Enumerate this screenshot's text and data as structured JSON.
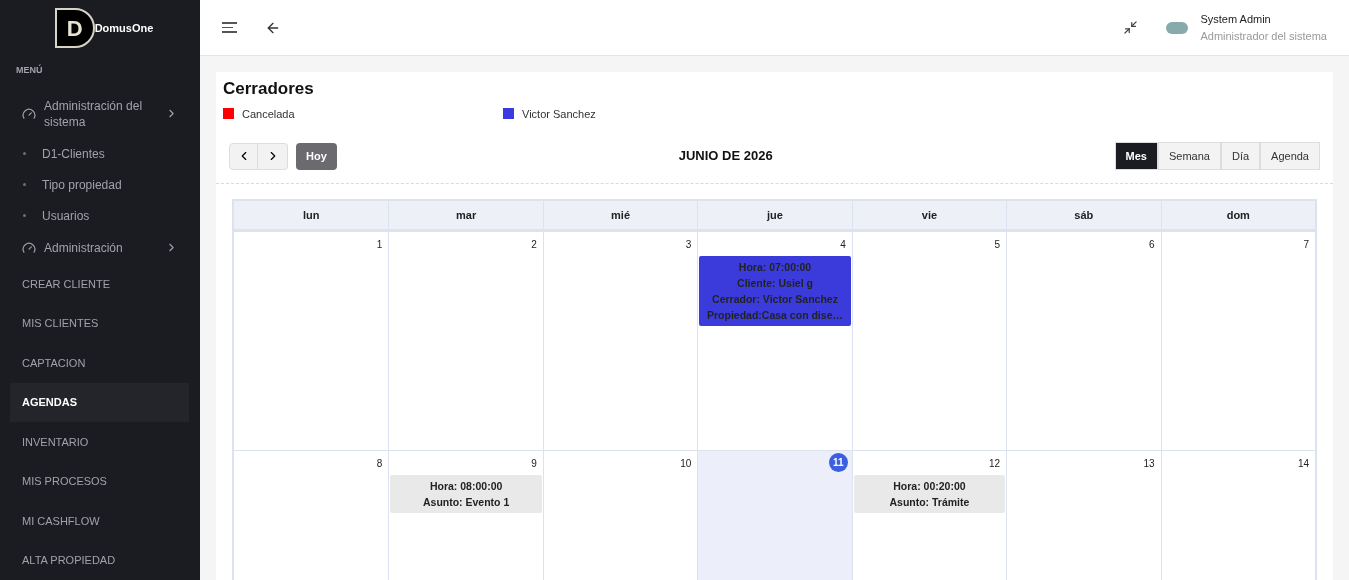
{
  "brand": {
    "logo_letter": "D",
    "name": "DomusOne"
  },
  "sidebar": {
    "heading": "MENÚ",
    "items": [
      {
        "kind": "group",
        "label": "Administración del sistema",
        "selected": false
      },
      {
        "kind": "sub",
        "label": "D1-Clientes",
        "selected": false
      },
      {
        "kind": "sub",
        "label": "Tipo propiedad",
        "selected": false
      },
      {
        "kind": "sub",
        "label": "Usuarios",
        "selected": false
      },
      {
        "kind": "group",
        "label": "Administración",
        "selected": false
      },
      {
        "kind": "link",
        "label": "CREAR CLIENTE",
        "selected": false
      },
      {
        "kind": "link",
        "label": "MIS CLIENTES",
        "selected": false
      },
      {
        "kind": "link",
        "label": "CAPTACION",
        "selected": false
      },
      {
        "kind": "link",
        "label": "AGENDAS",
        "selected": true
      },
      {
        "kind": "link",
        "label": "INVENTARIO",
        "selected": false
      },
      {
        "kind": "link",
        "label": "MIS PROCESOS",
        "selected": false
      },
      {
        "kind": "link",
        "label": "MI CASHFLOW",
        "selected": false
      },
      {
        "kind": "link",
        "label": "ALTA PROPIEDAD",
        "selected": false
      }
    ]
  },
  "user": {
    "name": "System Admin",
    "role": "Administrador del sistema"
  },
  "page": {
    "title": "Cerradores",
    "legend": [
      {
        "label": "Cancelada",
        "color": "#ff0000"
      },
      {
        "label": "Victor Sanchez",
        "color": "#3a3ae0"
      }
    ]
  },
  "toolbar": {
    "today_button": "Hoy",
    "period": "JUNIO DE 2026",
    "views": [
      {
        "label": "Mes",
        "selected": true
      },
      {
        "label": "Semana",
        "selected": false
      },
      {
        "label": "Día",
        "selected": false
      },
      {
        "label": "Agenda",
        "selected": false
      }
    ]
  },
  "calendar": {
    "weekdays": [
      "lun",
      "mar",
      "mié",
      "jue",
      "vie",
      "sáb",
      "dom"
    ],
    "weeks": [
      [
        {
          "day": "1",
          "today": false
        },
        {
          "day": "2",
          "today": false
        },
        {
          "day": "3",
          "today": false
        },
        {
          "day": "4",
          "today": false,
          "events": [
            {
              "color": "#3b3bdc",
              "lines": [
                "Hora: 07:00:00",
                "Cliente: Usiel g",
                "Cerrador: Victor Sanchez",
                "Propiedad:Casa con dise…"
              ]
            }
          ]
        },
        {
          "day": "5",
          "today": false
        },
        {
          "day": "6",
          "today": false
        },
        {
          "day": "7",
          "today": false
        }
      ],
      [
        {
          "day": "8",
          "today": false
        },
        {
          "day": "9",
          "today": false,
          "events": [
            {
              "color": "#e9e9e9",
              "lines": [
                "Hora: 08:00:00",
                "Asunto: Evento 1"
              ]
            }
          ]
        },
        {
          "day": "10",
          "today": false
        },
        {
          "day": "11",
          "today": true
        },
        {
          "day": "12",
          "today": false,
          "events": [
            {
              "color": "#e9e9e9",
              "lines": [
                "Hora: 00:20:00",
                "Asunto: Trámite"
              ]
            }
          ]
        },
        {
          "day": "13",
          "today": false
        },
        {
          "day": "14",
          "today": false
        }
      ]
    ]
  }
}
